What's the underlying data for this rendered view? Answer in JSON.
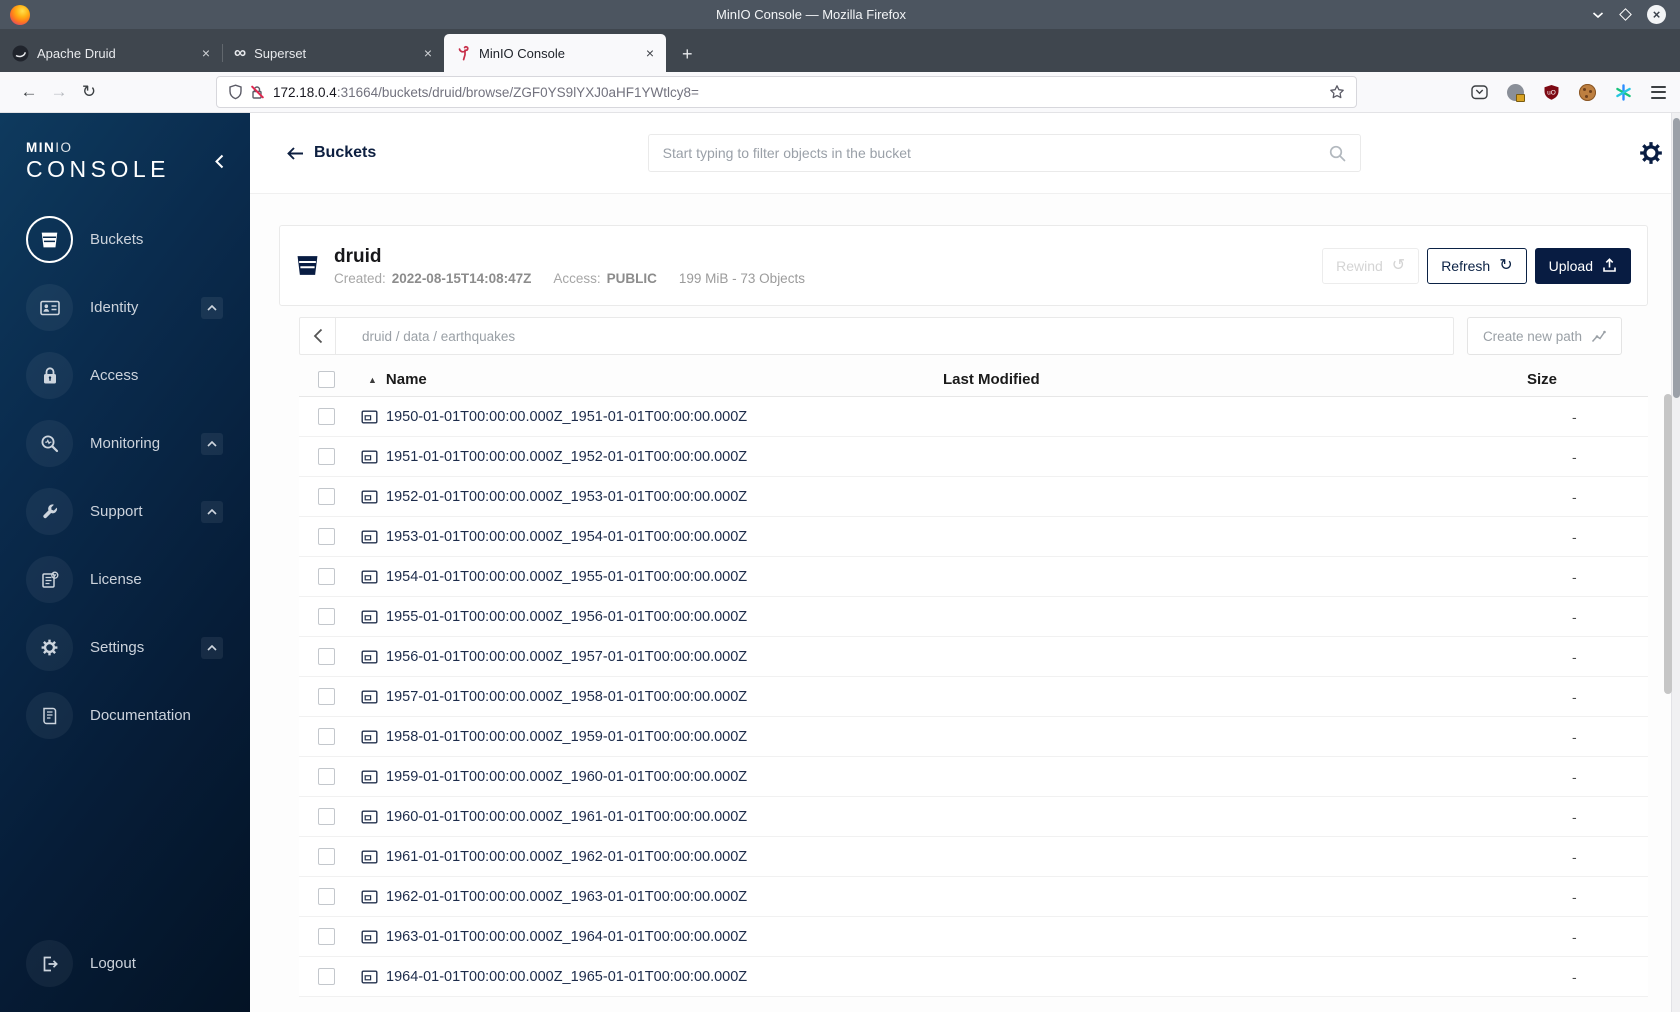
{
  "window": {
    "title": "MinIO Console — Mozilla Firefox"
  },
  "browser": {
    "tabs": [
      {
        "label": "Apache Druid"
      },
      {
        "label": "Superset"
      },
      {
        "label": "MinIO Console"
      }
    ],
    "toolbar": {
      "url_host": "172.18.0.4",
      "url_rest": ":31664/buckets/druid/browse/ZGF0YS9lYXJ0aHF1YWtlcy8="
    }
  },
  "sidebar": {
    "brand_bold": "MIN",
    "brand_light": "IO",
    "brand_sub": "CONSOLE",
    "items": [
      {
        "label": "Buckets",
        "icon": "bucket-icon",
        "active": true
      },
      {
        "label": "Identity",
        "icon": "identity-card-icon",
        "expandable": true
      },
      {
        "label": "Access",
        "icon": "padlock-icon",
        "expandable": false
      },
      {
        "label": "Monitoring",
        "icon": "monitoring-magnifier-icon",
        "expandable": true
      },
      {
        "label": "Support",
        "icon": "wrench-icon",
        "expandable": true
      },
      {
        "label": "License",
        "icon": "license-document-icon",
        "expandable": false
      },
      {
        "label": "Settings",
        "icon": "gear-icon",
        "expandable": true
      },
      {
        "label": "Documentation",
        "icon": "book-icon",
        "expandable": false
      }
    ],
    "logout": "Logout"
  },
  "header": {
    "back_label": "Buckets",
    "search_placeholder": "Start typing to filter objects in the bucket"
  },
  "bucket": {
    "name": "druid",
    "created_label": "Created:",
    "created_value": "2022-08-15T14:08:47Z",
    "access_label": "Access:",
    "access_value": "PUBLIC",
    "usage": "199 MiB - 73 Objects",
    "rewind_label": "Rewind",
    "refresh_label": "Refresh",
    "upload_label": "Upload"
  },
  "browse": {
    "breadcrumb": "druid / data / earthquakes",
    "create_path_label": "Create new path",
    "table": {
      "col_name": "Name",
      "col_modified": "Last Modified",
      "col_size": "Size",
      "sort_indicator": "▲",
      "rows": [
        {
          "name": "1950-01-01T00:00:00.000Z_1951-01-01T00:00:00.000Z",
          "modified": "",
          "size": "-"
        },
        {
          "name": "1951-01-01T00:00:00.000Z_1952-01-01T00:00:00.000Z",
          "modified": "",
          "size": "-"
        },
        {
          "name": "1952-01-01T00:00:00.000Z_1953-01-01T00:00:00.000Z",
          "modified": "",
          "size": "-"
        },
        {
          "name": "1953-01-01T00:00:00.000Z_1954-01-01T00:00:00.000Z",
          "modified": "",
          "size": "-"
        },
        {
          "name": "1954-01-01T00:00:00.000Z_1955-01-01T00:00:00.000Z",
          "modified": "",
          "size": "-"
        },
        {
          "name": "1955-01-01T00:00:00.000Z_1956-01-01T00:00:00.000Z",
          "modified": "",
          "size": "-"
        },
        {
          "name": "1956-01-01T00:00:00.000Z_1957-01-01T00:00:00.000Z",
          "modified": "",
          "size": "-"
        },
        {
          "name": "1957-01-01T00:00:00.000Z_1958-01-01T00:00:00.000Z",
          "modified": "",
          "size": "-"
        },
        {
          "name": "1958-01-01T00:00:00.000Z_1959-01-01T00:00:00.000Z",
          "modified": "",
          "size": "-"
        },
        {
          "name": "1959-01-01T00:00:00.000Z_1960-01-01T00:00:00.000Z",
          "modified": "",
          "size": "-"
        },
        {
          "name": "1960-01-01T00:00:00.000Z_1961-01-01T00:00:00.000Z",
          "modified": "",
          "size": "-"
        },
        {
          "name": "1961-01-01T00:00:00.000Z_1962-01-01T00:00:00.000Z",
          "modified": "",
          "size": "-"
        },
        {
          "name": "1962-01-01T00:00:00.000Z_1963-01-01T00:00:00.000Z",
          "modified": "",
          "size": "-"
        },
        {
          "name": "1963-01-01T00:00:00.000Z_1964-01-01T00:00:00.000Z",
          "modified": "",
          "size": "-"
        },
        {
          "name": "1964-01-01T00:00:00.000Z_1965-01-01T00:00:00.000Z",
          "modified": "",
          "size": "-"
        }
      ]
    }
  },
  "colors": {
    "brand_navy": "#081C42",
    "sidebar_gradient_top": "#0e3a5e",
    "sidebar_gradient_bottom": "#041325",
    "minio_red": "#c72e49",
    "insecure_red": "#e22850"
  },
  "icons": [
    "firefox-logo",
    "minimize-icon",
    "maximize-icon",
    "close-icon",
    "druid-tab-icon",
    "superset-tab-icon",
    "minio-flamingo-icon",
    "back-icon",
    "forward-icon",
    "reload-icon",
    "shield-icon",
    "insecure-lock-icon",
    "bookmark-star-icon",
    "pocket-icon",
    "extension-avatar-icon",
    "ublock-shield-icon",
    "cookie-icon",
    "color-asterisk-icon",
    "menu-hamburger-icon",
    "collapse-chevron-icon",
    "bucket-icon",
    "identity-card-icon",
    "padlock-icon",
    "monitoring-magnifier-icon",
    "wrench-icon",
    "license-document-icon",
    "gear-icon",
    "book-icon",
    "logout-icon",
    "search-icon",
    "rewind-icon",
    "refresh-icon",
    "upload-icon",
    "chevron-left-icon",
    "create-path-icon",
    "sort-asc-icon",
    "folder-icon",
    "checkbox"
  ]
}
